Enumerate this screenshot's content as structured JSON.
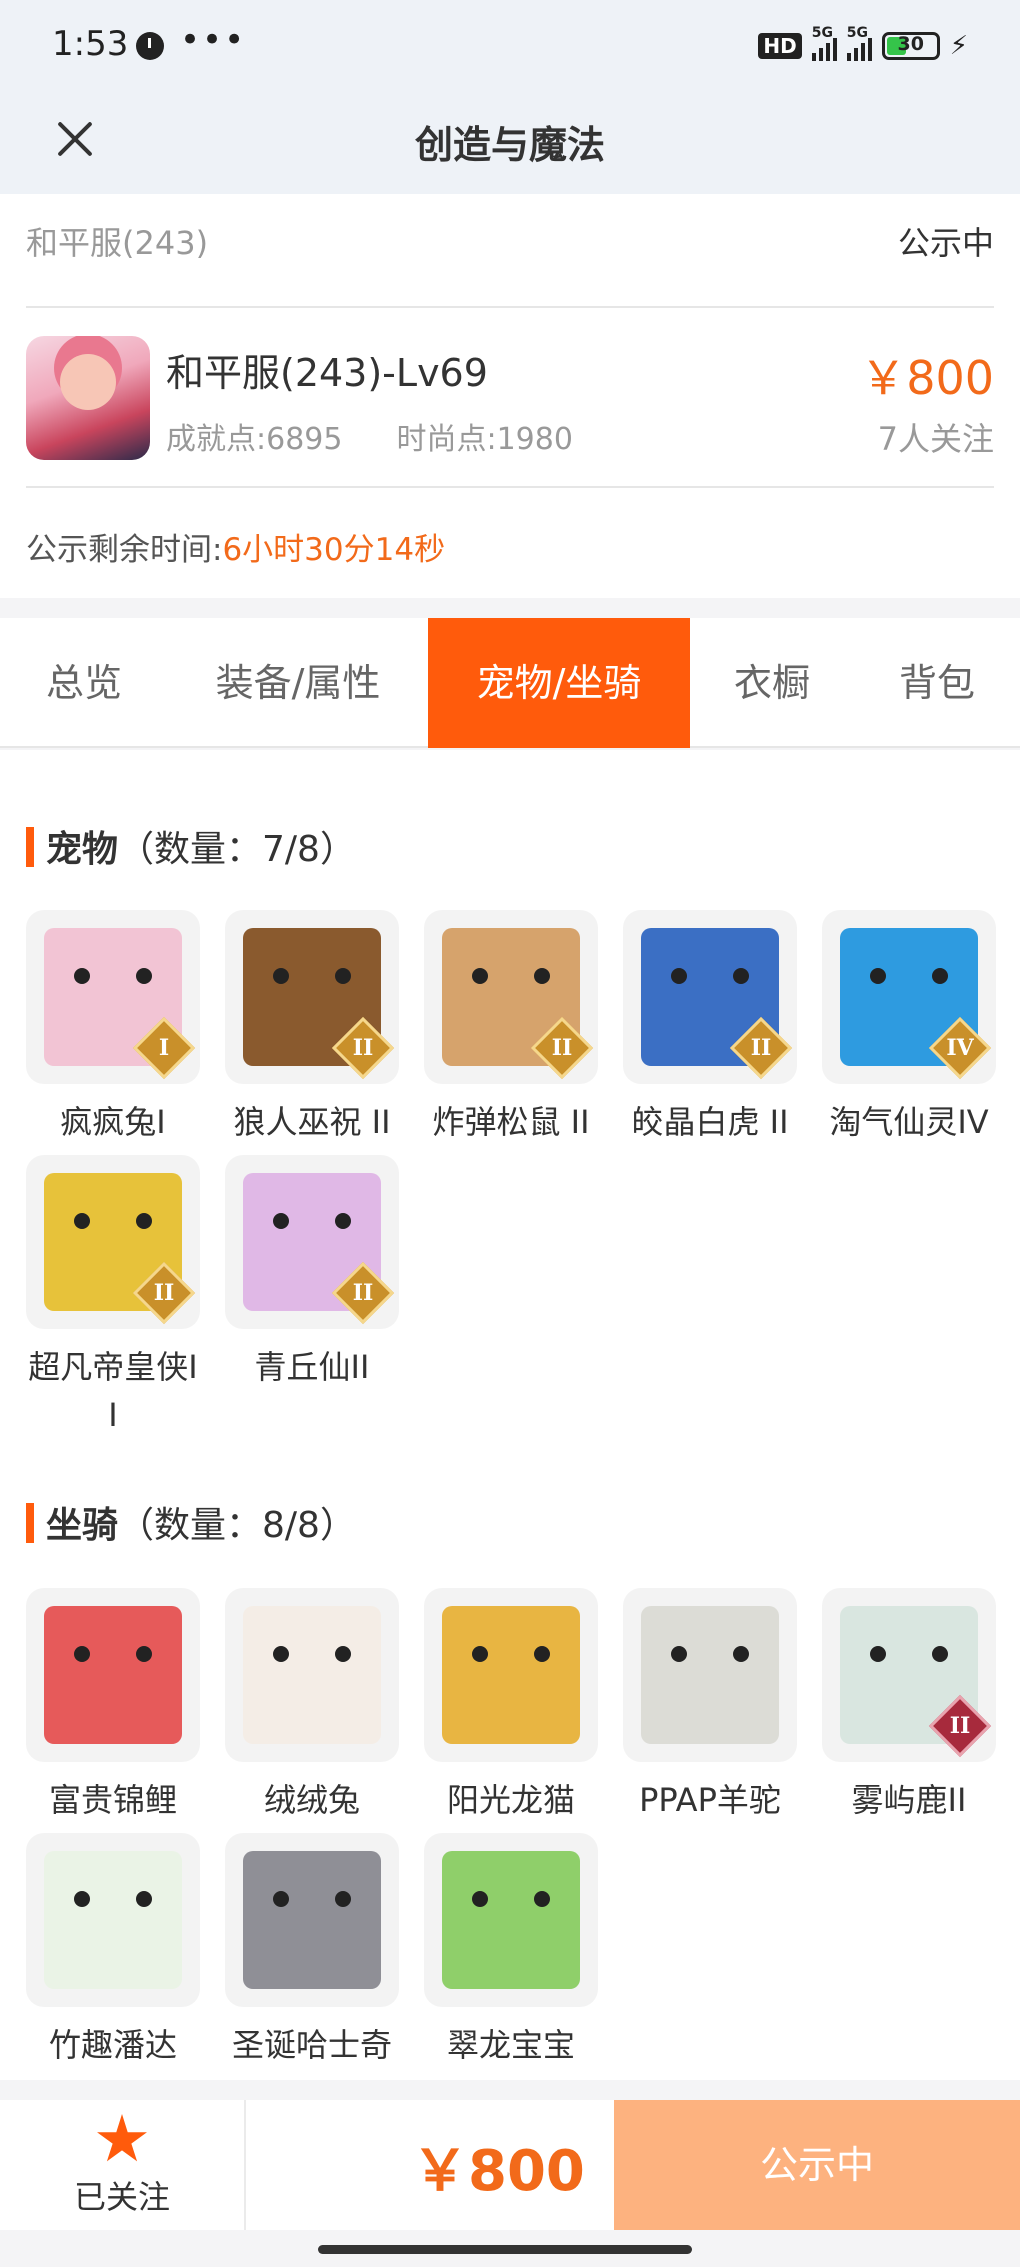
{
  "status_bar": {
    "time": "1:53",
    "dots": "•••",
    "hd": "HD",
    "net1": "5G",
    "net2": "5G",
    "battery": "30"
  },
  "nav": {
    "title": "创造与魔法"
  },
  "info": {
    "server": "和平服(243)",
    "status": "公示中",
    "role_name": "和平服(243)-Lv69",
    "achievement": "成就点:6895",
    "fashion": "时尚点:1980",
    "price": "￥800",
    "followers": "7人关注",
    "countdown_label": "公示剩余时间:",
    "countdown_value": "6小时30分14秒"
  },
  "tabs": [
    {
      "label": "总览"
    },
    {
      "label": "装备/属性"
    },
    {
      "label": "宠物/坐骑"
    },
    {
      "label": "衣橱"
    },
    {
      "label": "背包"
    }
  ],
  "pets": {
    "title": "宠物",
    "count": "（数量：7/8）",
    "items": [
      {
        "name": "疯疯兔I",
        "badge": "I",
        "color": "#f2c4d4"
      },
      {
        "name": "狼人巫祝 II",
        "badge": "II",
        "color": "#8a5a2e"
      },
      {
        "name": "炸弹松鼠 II",
        "badge": "II",
        "color": "#d6a36c"
      },
      {
        "name": "皎晶白虎 II",
        "badge": "II",
        "color": "#3b6fc4"
      },
      {
        "name": "淘气仙灵IV",
        "badge": "IV",
        "color": "#2e9be0"
      },
      {
        "name": "超凡帝皇侠II",
        "badge": "II",
        "color": "#e7c23a"
      },
      {
        "name": "青丘仙II",
        "badge": "II",
        "color": "#e0b8e6"
      }
    ]
  },
  "mounts": {
    "title": "坐骑",
    "count": "（数量：8/8）",
    "items": [
      {
        "name": "富贵锦鲤",
        "badge": "",
        "color": "#e65a5a"
      },
      {
        "name": "绒绒兔",
        "badge": "",
        "color": "#f4ede6"
      },
      {
        "name": "阳光龙猫",
        "badge": "",
        "color": "#e8b542"
      },
      {
        "name": "PPAP羊驼",
        "badge": "",
        "color": "#dcdcd6"
      },
      {
        "name": "雾屿鹿II",
        "badge": "II",
        "color": "#d9e6e0"
      },
      {
        "name": "竹趣潘达",
        "badge": "",
        "color": "#eaf3e6"
      },
      {
        "name": "圣诞哈士奇",
        "badge": "",
        "color": "#8f8f96"
      },
      {
        "name": "翠龙宝宝",
        "badge": "",
        "color": "#8fcf6a"
      }
    ]
  },
  "bottom": {
    "follow_label": "已关注",
    "price": "￥800",
    "status": "公示中"
  }
}
